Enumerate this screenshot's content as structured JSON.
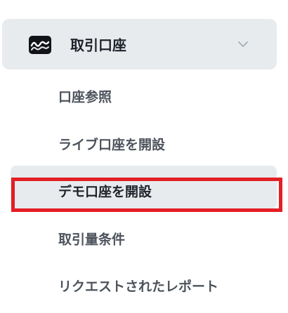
{
  "section": {
    "title": "取引口座",
    "icon": "chart-wave-icon",
    "expanded": true
  },
  "menu": {
    "items": [
      {
        "label": "口座参照"
      },
      {
        "label": "ライブ口座を開設"
      },
      {
        "label": "デモ口座を開設"
      },
      {
        "label": "取引量条件"
      },
      {
        "label": "リクエストされたレポート"
      }
    ],
    "active_index": 2
  },
  "colors": {
    "header_bg": "#e8ebee",
    "active_bg": "#e8ebee",
    "highlight_border": "#e31e24",
    "text_primary": "#1f232a",
    "text_secondary": "#4d535c"
  }
}
